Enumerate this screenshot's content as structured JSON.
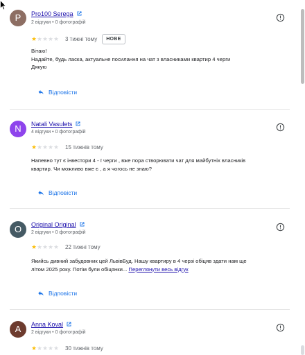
{
  "reviews": [
    {
      "avatar_letter": "P",
      "avatar_color": "#8d6e63",
      "name": "Pro100 Serega",
      "meta": "2 відгуки • 0 фотографій",
      "stars": 1,
      "time": "3 тижні тому",
      "badge": "НОВЕ",
      "text_lines": [
        "Вітаю!",
        "Надайте, будь ласка, актуальне посилання на чат з власниками квартир 4 черги",
        "Дякую"
      ],
      "reply_label": "Відповісти"
    },
    {
      "avatar_letter": "N",
      "avatar_color": "#8e44ec",
      "name": "Natali Vasulets",
      "meta": "4 відгуки • 0 фотографій",
      "stars": 1,
      "time": "15 тижнів тому",
      "text_lines": [
        "Напевно тут є інвестори 4 - ї черги , вже пора створювати чат для майбутніх власників",
        "квартир. Чи можливо вже є , а я чогось не знаю?"
      ],
      "reply_label": "Відповісти"
    },
    {
      "avatar_letter": "O",
      "avatar_color": "#455a64",
      "name": "Original Original",
      "meta": "2 відгуки • 0 фотографій",
      "stars": 1,
      "time": "22 тижні тому",
      "text_lines": [
        "Якийсь дивний забудовник цей ЛьвівБуд. Нашу квартиру в 4 черзі обіцяв здати нам ще",
        "літом 2025 року. Потім були обіцянки..."
      ],
      "more_label": "Переглянути весь відгук",
      "reply_label": "Відповісти"
    },
    {
      "avatar_letter": "A",
      "avatar_color": "#6d3b2e",
      "name": "Anna Koval",
      "meta": "2 відгуки • 0 фотографій",
      "stars": 1,
      "time": "30 тижнів тому"
    }
  ],
  "icons": {
    "external_link": "external-link-icon",
    "info": "info-icon",
    "reply": "reply-arrow-icon",
    "star": "star-icon"
  },
  "colors": {
    "link": "#1a0dab",
    "accent": "#1a73e8",
    "star_on": "#fbbc04",
    "star_off": "#dadce0"
  }
}
